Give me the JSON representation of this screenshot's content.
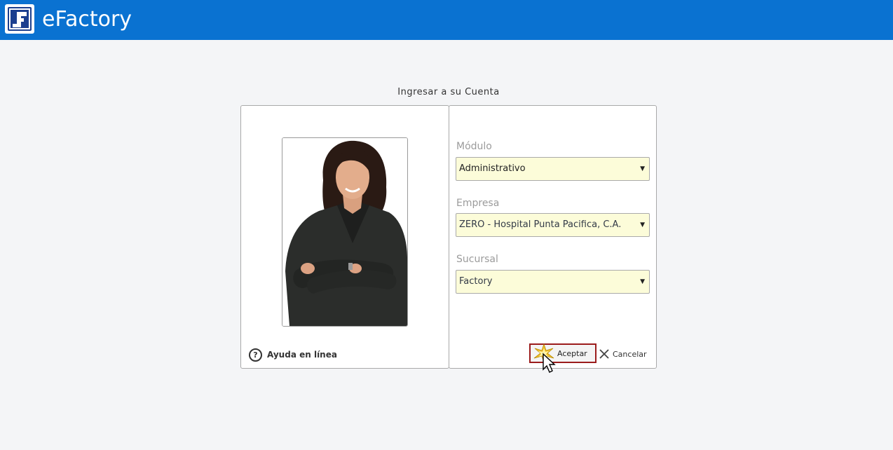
{
  "header": {
    "app_title": "eFactory",
    "logo_icon": "efactory-logo-icon",
    "bar_color": "#0a72d1"
  },
  "dialog": {
    "title": "Ingresar a su Cuenta"
  },
  "left_panel": {
    "photo": "businesswoman-photo",
    "help_icon": "question-circle-icon",
    "help_label": "Ayuda en línea"
  },
  "form": {
    "modulo": {
      "label": "Módulo",
      "value": "Administrativo"
    },
    "empresa": {
      "label": "Empresa",
      "value": "ZERO - Hospital Punta Pacifica, C.A."
    },
    "sucursal": {
      "label": "Sucursal",
      "value": "Factory"
    },
    "select_bg": "#fcfcd9"
  },
  "buttons": {
    "accept_label": "Aceptar",
    "accept_icon": "sparkle-icon",
    "cancel_label": "Cancelar",
    "cancel_icon": "close-icon",
    "accept_border": "#9b1c1c"
  }
}
